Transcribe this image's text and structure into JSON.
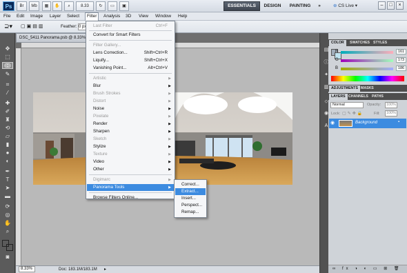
{
  "app": {
    "logo": "Ps",
    "bridge_label": "Br",
    "minibridge_label": "Mb",
    "zoom": "8.33",
    "workspaces": [
      "ESSENTIALS",
      "DESIGN",
      "PAINTING"
    ],
    "more": "»",
    "cs_live": "CS Live"
  },
  "menu": [
    "File",
    "Edit",
    "Image",
    "Layer",
    "Select",
    "Filter",
    "Analysis",
    "3D",
    "View",
    "Window",
    "Help"
  ],
  "options": {
    "feather_label": "Feather:",
    "feather_value": "0 px"
  },
  "document": {
    "tab_title": "DSC_5411 Panorama.psb @ 8.33%",
    "status_zoom": "8.33%",
    "status_doc": "Doc: 183.1M/183.1M"
  },
  "filter_menu": {
    "items": [
      {
        "label": "Last Filter",
        "shortcut": "Ctrl+F",
        "disabled": true
      },
      {
        "label": "Convert for Smart Filters"
      },
      {
        "label": "Filter Gallery...",
        "disabled": true
      },
      {
        "label": "Lens Correction...",
        "shortcut": "Shift+Ctrl+R"
      },
      {
        "label": "Liquify...",
        "shortcut": "Shift+Ctrl+X"
      },
      {
        "label": "Vanishing Point...",
        "shortcut": "Alt+Ctrl+V"
      },
      {
        "label": "Artistic",
        "disabled": true,
        "sub": true
      },
      {
        "label": "Blur",
        "sub": true
      },
      {
        "label": "Brush Strokes",
        "disabled": true,
        "sub": true
      },
      {
        "label": "Distort",
        "disabled": true,
        "sub": true
      },
      {
        "label": "Noise",
        "sub": true
      },
      {
        "label": "Pixelate",
        "disabled": true,
        "sub": true
      },
      {
        "label": "Render",
        "sub": true
      },
      {
        "label": "Sharpen",
        "sub": true
      },
      {
        "label": "Sketch",
        "disabled": true,
        "sub": true
      },
      {
        "label": "Stylize",
        "sub": true
      },
      {
        "label": "Texture",
        "disabled": true,
        "sub": true
      },
      {
        "label": "Video",
        "sub": true
      },
      {
        "label": "Other",
        "sub": true
      },
      {
        "label": "Digimarc",
        "disabled": true,
        "sub": true
      },
      {
        "label": "Panorama Tools",
        "sub": true,
        "highlight": true
      },
      {
        "label": "Browse Filters Online..."
      }
    ],
    "submenu": [
      "Correct...",
      "Extract...",
      "Insert...",
      "Perspect...",
      "Remap..."
    ],
    "submenu_highlight": 1
  },
  "color_panel": {
    "tabs": [
      "COLOR",
      "SWATCHES",
      "STYLES"
    ],
    "channels": [
      {
        "name": "R",
        "value": "161"
      },
      {
        "name": "G",
        "value": "173"
      },
      {
        "name": "B",
        "value": "186"
      }
    ]
  },
  "adjust_tabs": [
    "ADJUSTMENTS",
    "MASKS"
  ],
  "layers_panel": {
    "tabs": [
      "LAYERS",
      "CHANNELS",
      "PATHS"
    ],
    "blend_mode": "Normal",
    "opacity_label": "Opacity:",
    "opacity_value": "100%",
    "lock_label": "Lock:",
    "fill_label": "Fill:",
    "fill_value": "100%",
    "layer_name": "Background"
  },
  "colors": {
    "accent": "#3c8be0",
    "layer_selected": "#3c8be0",
    "foreground": "#7ec3e6",
    "background": "#ffffff"
  }
}
